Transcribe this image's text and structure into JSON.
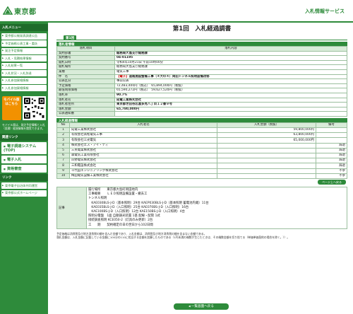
{
  "header": {
    "logo_text": "東京都",
    "service_title": "入札情報サービス"
  },
  "sidebar": {
    "menu_title": "入札メニュー",
    "menu_items": [
      "東京都公報発表調達公告",
      "予定価格公表工事・委託",
      "発注予定情報",
      "入札・見積結果情報",
      "入札結果一覧",
      "入札状況・入札辞退",
      "入札参加資格情報",
      "入札参加資格情報"
    ],
    "mobile_label_1": "モバイル版",
    "mobile_label_2": "はこちら",
    "mobile_note": "モバイル版は、発注予定情報と入札（見積）経過情報を閲覧できます。",
    "links_title": "関連リンク",
    "link_items": [
      "電子調達システム(TOP)",
      "電子入札",
      "資格審査"
    ],
    "links2_title": "リンク",
    "link2_items": [
      "東京電子自治体共同運営",
      "東京都公式ホームページ"
    ]
  },
  "main": {
    "page_title": "第1回　入札経過調書",
    "tab_label": "第1回",
    "section1": "落札者情報",
    "info_head": {
      "col1": "落札項目",
      "col2": "落札内容"
    },
    "info_rows": [
      {
        "label": "契約部署",
        "value": "総務局大島支庁総務課",
        "bold": true
      },
      {
        "label": "契約番号",
        "value": "04-01195",
        "bold": true
      },
      {
        "label": "開札日時",
        "value": "令和4年10月21日 午前10時00分",
        "bold": false
      },
      {
        "label": "開札場所",
        "value": "総務局大島支庁総務課",
        "bold": false
      },
      {
        "label": "業種",
        "value": "電気工事",
        "bold": false
      },
      {
        "label": "件　名",
        "value": "道路施設整備工事（４大の４）岡田トンネル照明設備改修",
        "bold": true,
        "badge": "【電子】"
      },
      {
        "label": "公表区分",
        "value": "事前公表",
        "bold": false
      },
      {
        "label": "予定価格",
        "value": "72,483,400円（税込）　65,894,000円（税抜）",
        "bold": false
      },
      {
        "label": "最低制限価格",
        "value": "65,590,272円（税込）　59,627,520円（税抜）",
        "bold": false
      },
      {
        "label": "落札率",
        "value": "90.7%",
        "bold": true
      },
      {
        "label": "落札者名",
        "value": "成電工業株式会社",
        "bold": true
      },
      {
        "label": "落札者住所",
        "value": "東京都世田谷区喜多見八丁目１２番９号",
        "bold": true
      },
      {
        "label": "落札金額",
        "value": "65,780,000円",
        "bold": true
      },
      {
        "label": "公表通知番",
        "value": "",
        "bold": false
      }
    ],
    "section2": "入札経過情報",
    "bid_head": {
      "no": "No",
      "name": "入札者名",
      "amount": "入札金額（税抜）",
      "remark": "備考"
    },
    "bids": [
      {
        "no": "1",
        "name": "成電工業株式会社",
        "amount": "59,800,000円",
        "remark": ""
      },
      {
        "no": "2",
        "name": "有限会社高松電気工事",
        "amount": "63,800,000円",
        "remark": ""
      },
      {
        "no": "3",
        "name": "有限会社三光電気",
        "amount": "65,000,000円",
        "remark": ""
      },
      {
        "no": "4",
        "name": "株式会社エス・アイ・ティ",
        "amount": "",
        "remark": "辞退"
      },
      {
        "no": "5",
        "name": "三英電業株式会社",
        "amount": "",
        "remark": "辞退"
      },
      {
        "no": "6",
        "name": "森電気工業有限会社",
        "amount": "",
        "remark": "辞退"
      },
      {
        "no": "7",
        "name": "岸野電気株式会社",
        "amount": "",
        "remark": "辞退"
      },
      {
        "no": "8",
        "name": "三和電設株式会社",
        "amount": "",
        "remark": "辞退"
      },
      {
        "no": "9",
        "name": "千代田エンジニアリング株式会社",
        "amount": "",
        "remark": "不参"
      },
      {
        "no": "10",
        "name": "梅田電気設備工業株式会社",
        "amount": "",
        "remark": "不参"
      }
    ],
    "small_back": "ページ上へ戻る",
    "memo_label": "記事",
    "memo_lines": [
      "履行場所　　東京都大島町岡田地内",
      "工事概要　　ＬＥＤ照明設備設置・撤去工",
      "トンネル照明",
      "　KAE030BLS-J-D（基本照明）29台 KAEP030BLS-J-D（基本照明 蓄電池内蔵）11台",
      "　KAE035BLS-J-D（入口照明）25台 KAE070BS-J-D（入口照明）16台",
      "　KAE100BS-J-D（入口照明）12台 KAE150BS-J-D（入口照明）4台",
      "照明分電盤　1面 自動調光装置 1基 配線・配管 1式",
      "接続調査照明 KCE050-2（灯具のみ更新）2台",
      "工　　期　　契約確定の日の翌日から102日間"
    ],
    "footnote_1": "予定価格は消費税及び地方消費税の額を含んだ金額であり、入札金額は、消費税及び地方消費税の額を含まない金額である。",
    "footnote_2": "落札金額は、入札金額に記載している金額に100分の110に相当する金額を加算したものである（1円未満の端数が生じたときは、その端数金額を切り捨てる（単価単価契約の場合を除く。））。",
    "back_button": "一覧画面へ戻る"
  }
}
